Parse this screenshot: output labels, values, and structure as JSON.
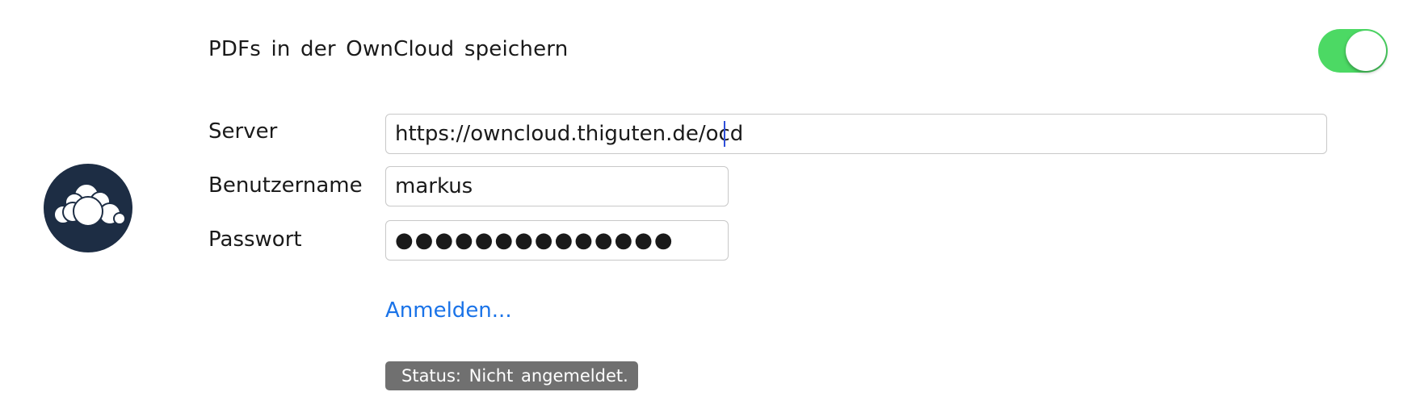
{
  "settings": {
    "save_pdfs_label": "PDFs in der OwnCloud speichern",
    "save_pdfs_enabled": true
  },
  "form": {
    "server_label": "Server",
    "server_value": "https://owncloud.thiguten.de/ocd",
    "username_label": "Benutzername",
    "username_value": "markus",
    "password_label": "Passwort",
    "password_value": "●●●●●●●●●●●●●●",
    "login_link": "Anmelden..."
  },
  "status": {
    "text": "Status: Nicht angemeldet."
  },
  "icons": {
    "logo": "owncloud-logo-icon"
  },
  "colors": {
    "toggle_on": "#4cd964",
    "link": "#1a73e8",
    "logo_background": "#1d2d44",
    "status_background": "#707070"
  }
}
